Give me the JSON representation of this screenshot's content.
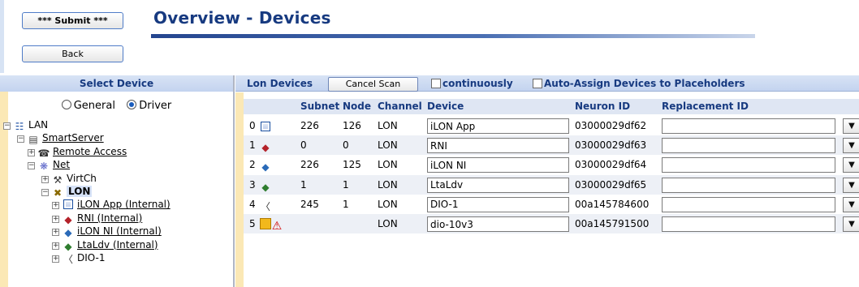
{
  "header": {
    "submit_label": "*** Submit ***",
    "back_label": "Back",
    "page_title": "Overview - Devices"
  },
  "left_panel": {
    "heading": "Select Device",
    "radio_general": "General",
    "radio_driver": "Driver",
    "selected_view": "Driver",
    "tree": [
      {
        "label": "LAN",
        "level": 0,
        "icon": "network-icon",
        "expander": "minus"
      },
      {
        "label": "SmartServer",
        "level": 1,
        "icon": "server-icon",
        "expander": "minus",
        "link": true
      },
      {
        "label": "Remote Access",
        "level": 2,
        "icon": "phone-icon",
        "expander": "plus",
        "link": true
      },
      {
        "label": "Net",
        "level": 2,
        "icon": "net-icon",
        "expander": "minus",
        "link": true
      },
      {
        "label": "VirtCh",
        "level": 3,
        "icon": "virtual-channel-icon",
        "expander": "plus"
      },
      {
        "label": "LON",
        "level": 3,
        "icon": "lon-channel-icon",
        "expander": "minus",
        "selected": true
      },
      {
        "label": "iLON App (Internal)",
        "level": 4,
        "icon": "ilon-app-icon",
        "expander": "plus",
        "link": true
      },
      {
        "label": "RNI (Internal)",
        "level": 4,
        "icon": "rni-icon",
        "expander": "plus",
        "link": true
      },
      {
        "label": "iLON NI (Internal)",
        "level": 4,
        "icon": "ilon-ni-icon",
        "expander": "plus",
        "link": true
      },
      {
        "label": "LtaLdv (Internal)",
        "level": 4,
        "icon": "ltaldv-icon",
        "expander": "plus",
        "link": true
      },
      {
        "label": "DIO-1",
        "level": 4,
        "icon": "dio-icon",
        "expander": "plus"
      }
    ]
  },
  "toolbar": {
    "title": "Lon Devices",
    "cancel_scan_label": "Cancel Scan",
    "continuously_label": "continuously",
    "continuously_checked": false,
    "auto_assign_label": "Auto-Assign Devices to Placeholders",
    "auto_assign_checked": false
  },
  "table": {
    "headers": {
      "subnet": "Subnet",
      "node": "Node",
      "channel": "Channel",
      "device": "Device",
      "neuron_id": "Neuron ID",
      "replacement_id": "Replacement ID"
    },
    "rows": [
      {
        "index": "0",
        "icon": "ilon-app-icon",
        "subnet": "226",
        "node": "126",
        "channel": "LON",
        "device": "iLON App",
        "neuron_id": "03000029df62",
        "replacement_id": ""
      },
      {
        "index": "1",
        "icon": "rni-icon",
        "subnet": "0",
        "node": "0",
        "channel": "LON",
        "device": "RNI",
        "neuron_id": "03000029df63",
        "replacement_id": ""
      },
      {
        "index": "2",
        "icon": "ilon-ni-icon",
        "subnet": "226",
        "node": "125",
        "channel": "LON",
        "device": "iLON NI",
        "neuron_id": "03000029df64",
        "replacement_id": ""
      },
      {
        "index": "3",
        "icon": "ltaldv-icon",
        "subnet": "1",
        "node": "1",
        "channel": "LON",
        "device": "LtaLdv",
        "neuron_id": "03000029df65",
        "replacement_id": ""
      },
      {
        "index": "4",
        "icon": "dio-icon",
        "subnet": "245",
        "node": "1",
        "channel": "LON",
        "device": "DIO-1",
        "neuron_id": "00a145784600",
        "replacement_id": ""
      },
      {
        "index": "5",
        "icon": "unconfigured-device-icon",
        "subnet": "",
        "node": "",
        "channel": "LON",
        "device": "dio-10v3",
        "neuron_id": "00a145791500",
        "replacement_id": ""
      }
    ]
  },
  "colors": {
    "title_blue": "#173a80",
    "header_band": "#c3d3ef",
    "gutter": "#fbe8b5",
    "warning_red": "#d10000"
  }
}
